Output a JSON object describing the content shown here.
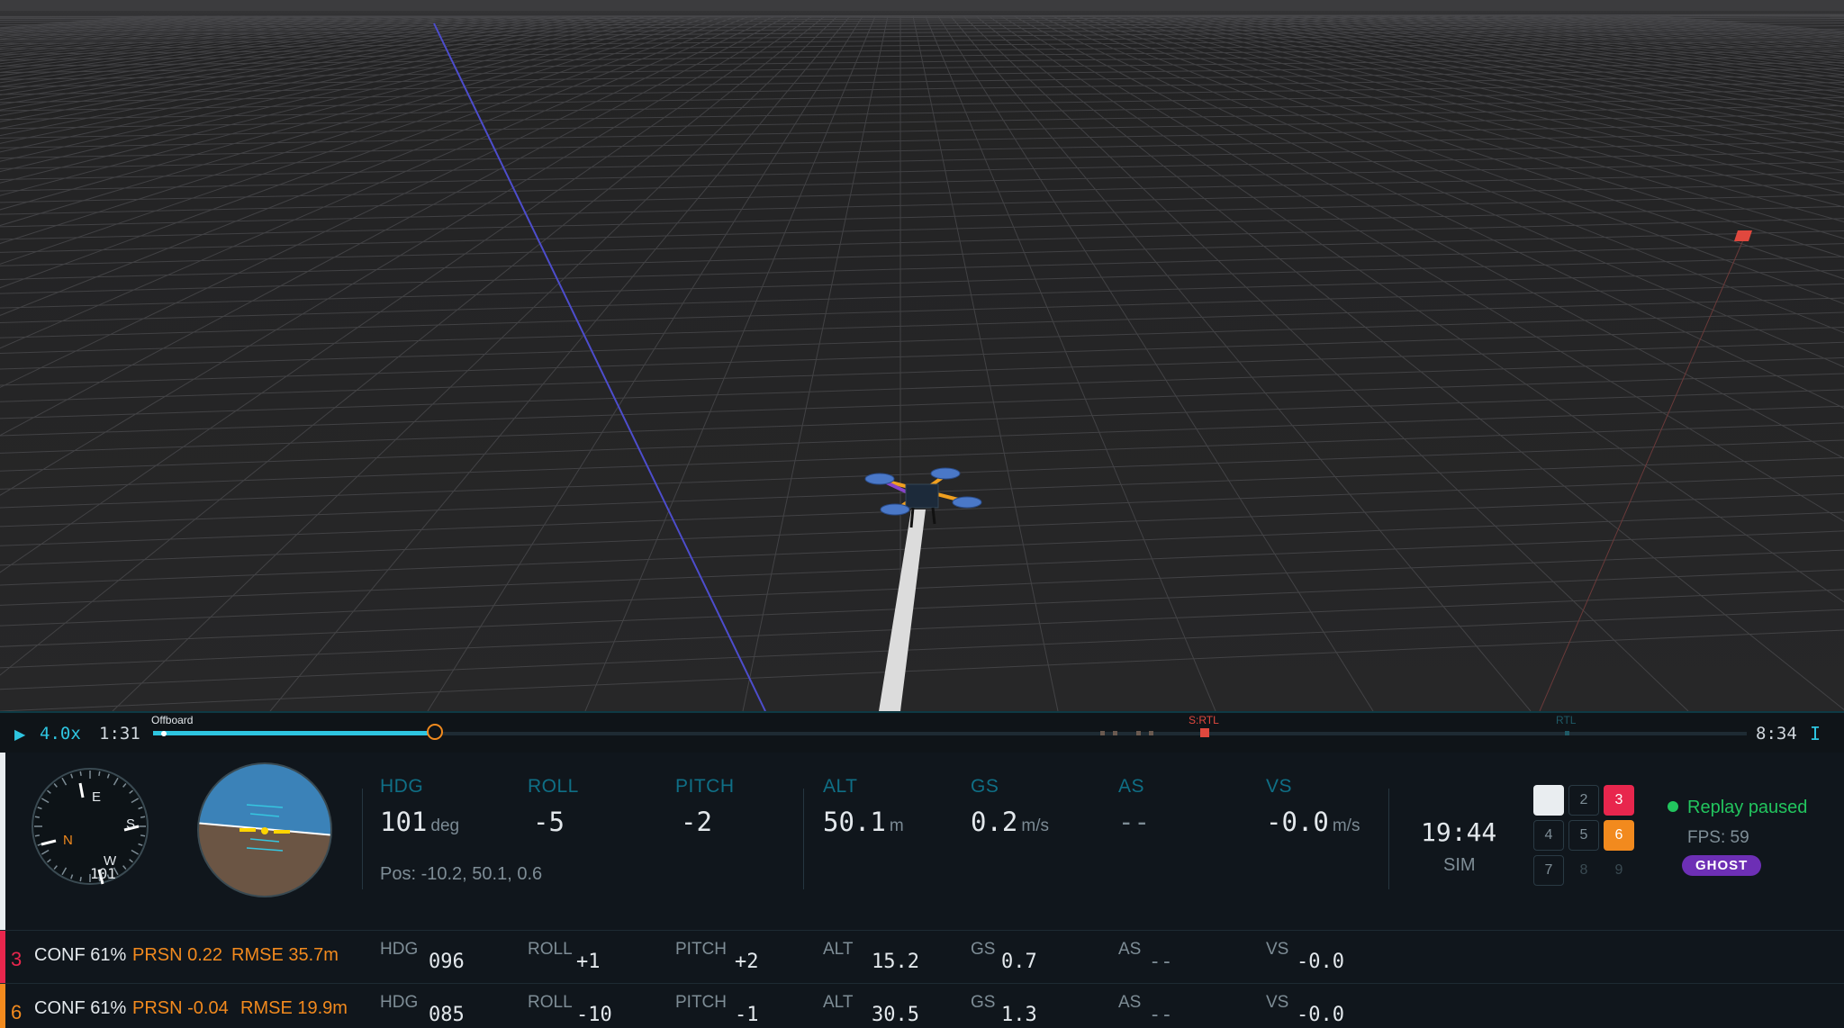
{
  "timeline": {
    "speed": "4.0x",
    "current_time": "1:31",
    "end_time": "8:34",
    "mode_label": "Offboard",
    "event_srtl": "S:RTL",
    "event_rtl": "RTL",
    "cursor": "I",
    "progress": 0.136
  },
  "compass": {
    "n": "N",
    "e": "E",
    "s": "S",
    "w": "W",
    "heading": "101"
  },
  "telemetry": {
    "hdg": {
      "label": "HDG",
      "value": "101",
      "unit": "deg"
    },
    "roll": {
      "label": "ROLL",
      "value": "-5"
    },
    "pitch": {
      "label": "PITCH",
      "value": "-2"
    },
    "alt": {
      "label": "ALT",
      "value": "50.1",
      "unit": "m"
    },
    "gs": {
      "label": "GS",
      "value": "0.2",
      "unit": "m/s"
    },
    "as": {
      "label": "AS",
      "value": "--"
    },
    "vs": {
      "label": "VS",
      "value": "-0.0",
      "unit": "m/s"
    },
    "pos": "Pos: -10.2, 50.1, 0.6"
  },
  "clock": {
    "time": "19:44",
    "source": "SIM"
  },
  "vehicle_grid": [
    "",
    "2",
    "3",
    "4",
    "5",
    "6",
    "7",
    "8",
    "9"
  ],
  "status": {
    "text": "Replay paused",
    "fps": "FPS: 59",
    "badge": "GHOST"
  },
  "vehicles": [
    {
      "num": "3",
      "color": "#e8264d",
      "conf": "CONF 61%",
      "prsn": "PRSN 0.22",
      "rmse": "RMSE 35.7m",
      "hdg_label": "HDG",
      "hdg": "096",
      "roll_label": "ROLL",
      "roll": "+1",
      "pitch_label": "PITCH",
      "pitch": "+2",
      "alt_label": "ALT",
      "alt": "15.2",
      "gs_label": "GS",
      "gs": "0.7",
      "as_label": "AS",
      "as": "--",
      "vs_label": "VS",
      "vs": "-0.0"
    },
    {
      "num": "6",
      "color": "#f28a1e",
      "conf": "CONF 61%",
      "prsn": "PRSN -0.04",
      "rmse": "RMSE 19.9m",
      "hdg_label": "HDG",
      "hdg": "085",
      "roll_label": "ROLL",
      "roll": "-10",
      "pitch_label": "PITCH",
      "pitch": "-1",
      "alt_label": "ALT",
      "alt": "30.5",
      "gs_label": "GS",
      "gs": "1.3",
      "as_label": "AS",
      "as": "--",
      "vs_label": "VS",
      "vs": "-0.0"
    }
  ],
  "colors": {
    "accent": "#2ec5e0",
    "warning": "#f28a1e",
    "danger": "#e8264d",
    "ok": "#22c55e",
    "ghost": "#6d2fb5"
  }
}
